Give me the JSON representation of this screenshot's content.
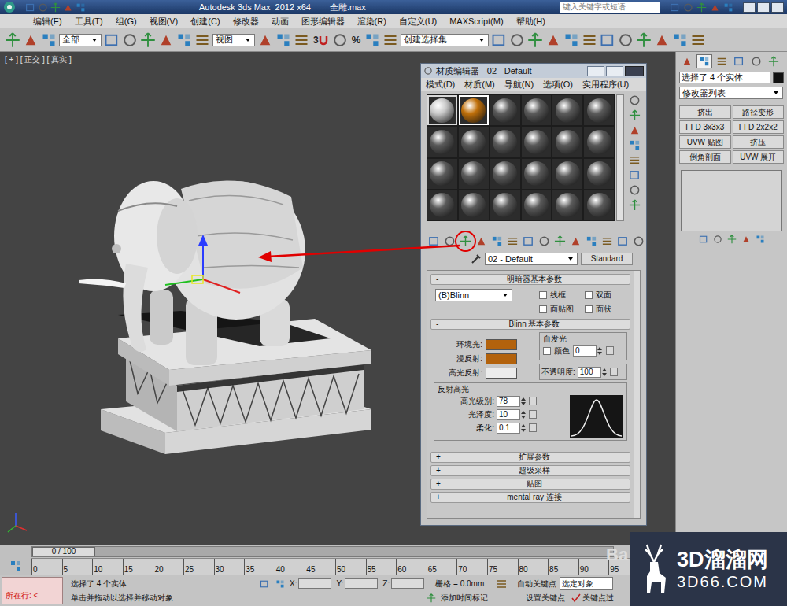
{
  "titlebar": {
    "app": "Autodesk 3ds Max  2012 x64",
    "file": "全雕.max",
    "search_placeholder": "键入关键字或短语"
  },
  "menubar": [
    "编辑(E)",
    "工具(T)",
    "组(G)",
    "视图(V)",
    "创建(C)",
    "修改器",
    "动画",
    "图形编辑器",
    "渲染(R)",
    "自定义(U)",
    "MAXScript(M)",
    "帮助(H)"
  ],
  "toolbar": {
    "selection_filter": "全部",
    "reference_coord": "视图",
    "selection_set": "创建选择集",
    "snap_toggle": "3",
    "percent_snap": "%"
  },
  "viewport": {
    "label": "[ + ] [ 正交 ] [ 真实 ]"
  },
  "material_editor": {
    "title": "材质编辑器 - 02 - Default",
    "menus": [
      "模式(D)",
      "材质(M)",
      "导航(N)",
      "选项(O)",
      "实用程序(U)"
    ],
    "slots": [
      {
        "color": "#c8c8c8",
        "selected": false
      },
      {
        "color": "#c0700a",
        "selected": true
      },
      {
        "color": "#5a5a5a",
        "selected": false
      },
      {
        "color": "#5a5a5a",
        "selected": false
      },
      {
        "color": "#5a5a5a",
        "selected": false
      },
      {
        "color": "#5a5a5a",
        "selected": false
      },
      {
        "color": "#5a5a5a",
        "selected": false
      },
      {
        "color": "#5a5a5a",
        "selected": false
      },
      {
        "color": "#5a5a5a",
        "selected": false
      },
      {
        "color": "#5a5a5a",
        "selected": false
      },
      {
        "color": "#5a5a5a",
        "selected": false
      },
      {
        "color": "#5a5a5a",
        "selected": false
      },
      {
        "color": "#5a5a5a",
        "selected": false
      },
      {
        "color": "#5a5a5a",
        "selected": false
      },
      {
        "color": "#5a5a5a",
        "selected": false
      },
      {
        "color": "#5a5a5a",
        "selected": false
      },
      {
        "color": "#5a5a5a",
        "selected": false
      },
      {
        "color": "#5a5a5a",
        "selected": false
      },
      {
        "color": "#5a5a5a",
        "selected": false
      },
      {
        "color": "#5a5a5a",
        "selected": false
      },
      {
        "color": "#5a5a5a",
        "selected": false
      },
      {
        "color": "#5a5a5a",
        "selected": false
      },
      {
        "color": "#5a5a5a",
        "selected": false
      },
      {
        "color": "#5a5a5a",
        "selected": false
      }
    ],
    "material_name": "02 - Default",
    "material_type": "Standard",
    "shader_rollout": {
      "sign": "-",
      "title": "明暗器基本参数",
      "shader": "(B)Blinn",
      "options": [
        {
          "label": "线框",
          "checked": false
        },
        {
          "label": "双面",
          "checked": false
        },
        {
          "label": "面贴图",
          "checked": false
        },
        {
          "label": "面状",
          "checked": false
        }
      ]
    },
    "blinn_rollout": {
      "sign": "-",
      "title": "Blinn 基本参数",
      "colors": [
        {
          "label": "环境光:",
          "color": "#b3620c"
        },
        {
          "label": "漫反射:",
          "color": "#b3620c"
        },
        {
          "label": "高光反射:",
          "color": "#ececec"
        }
      ],
      "self_illum": {
        "title": "自发光",
        "label": "颜色",
        "checked": false,
        "value": "0"
      },
      "opacity": {
        "label": "不透明度:",
        "value": "100"
      },
      "specular": {
        "title": "反射高光",
        "fields": [
          {
            "label": "高光级别:",
            "value": "78"
          },
          {
            "label": "光泽度:",
            "value": "10"
          },
          {
            "label": "柔化:",
            "value": "0.1"
          }
        ]
      }
    },
    "collapsed_rollouts": [
      {
        "sign": "+",
        "title": "扩展参数"
      },
      {
        "sign": "+",
        "title": "超级采样"
      },
      {
        "sign": "+",
        "title": "贴图"
      },
      {
        "sign": "+",
        "title": "mental ray 连接"
      }
    ]
  },
  "command_panel": {
    "tabs": [
      {
        "selected": false
      },
      {
        "selected": true
      },
      {
        "selected": false
      },
      {
        "selected": false
      },
      {
        "selected": false
      },
      {
        "selected": false
      }
    ],
    "selection": "选择了 4 个实体",
    "modifier_list": "修改器列表",
    "buttons": [
      "挤出",
      "路径变形",
      "FFD 3x3x3",
      "FFD 2x2x2",
      "UVW 贴图",
      "挤压",
      "倒角剖面",
      "UVW 展开"
    ]
  },
  "timeline": {
    "position": "0 / 100",
    "level": 0,
    "ticks": [
      "0",
      "5",
      "10",
      "15",
      "20",
      "25",
      "30",
      "35",
      "40",
      "45",
      "50",
      "55",
      "60",
      "65",
      "70",
      "75",
      "80",
      "85",
      "90",
      "95"
    ]
  },
  "status_bar": {
    "script_listener": "所在行: <",
    "selection": "选择了 4 个实体",
    "prompt": "单击并拖动以选择并移动对象",
    "coords": [
      "X:",
      "Y:",
      "Z:"
    ],
    "grid": "栅格 = 0.0mm",
    "add_time_tag": "添加时间标记",
    "auto_key": "自动关键点",
    "key_mode": "选定对象",
    "set_key": "设置关键点",
    "key_filters": "关键点过"
  },
  "watermark": {
    "brand": "3D溜溜网",
    "url": "3D66.COM",
    "baidu": "Ba"
  }
}
